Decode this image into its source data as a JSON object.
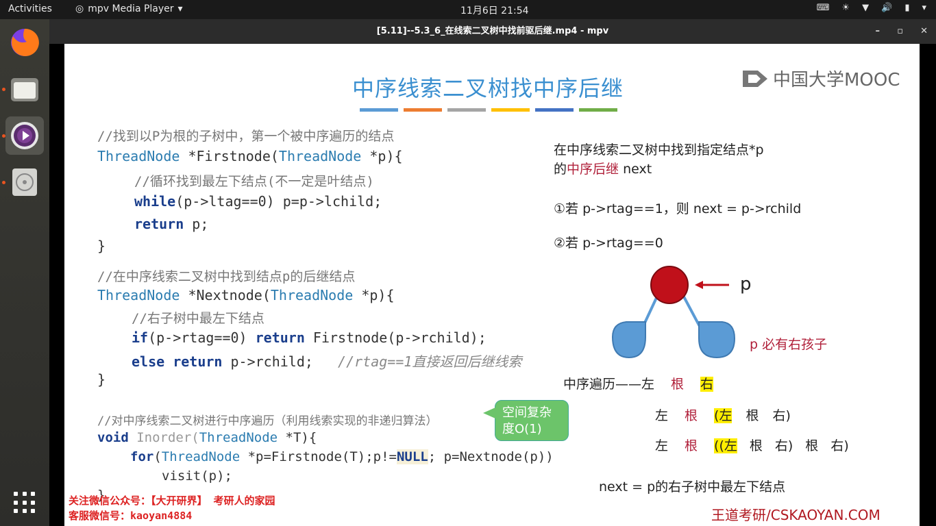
{
  "topbar": {
    "activities": "Activities",
    "app_menu": "mpv Media Player",
    "clock": "11月6日  21:54"
  },
  "window": {
    "title": "[5.11]--5.3_6_在线索二叉树中找前驱后继.mp4 - mpv",
    "minimize": "–",
    "maximize": "▫",
    "close": "✕"
  },
  "slide": {
    "title": "中序线索二叉树找中序后继",
    "logo_text": "中国大学MOOC",
    "bar_colors": [
      "#5b9bd5",
      "#ed7d31",
      "#a5a5a5",
      "#ffc000",
      "#4472c4",
      "#70ad47"
    ],
    "code1": {
      "comment": "//找到以P为根的子树中，第一个被中序遍历的结点",
      "sig_type": "ThreadNode",
      "sig_rest": " *Firstnode(",
      "sig_type2": "ThreadNode",
      "sig_end": " *p){",
      "loop_comment": "//循环找到最左下结点(不一定是叶结点)",
      "while_kw": "while",
      "while_body": "(p->ltag==0) p=p->lchild;",
      "return_kw": "return",
      "return_body": " p;",
      "close": "}"
    },
    "code2": {
      "comment": "//在中序线索二叉树中找到结点p的后继结点",
      "sig_type": "ThreadNode",
      "sig_rest": " *Nextnode(",
      "sig_type2": "ThreadNode",
      "sig_end": " *p){",
      "sub_comment": "//右子树中最左下结点",
      "if_kw": "if",
      "if_body": "(p->rtag==0) ",
      "if_return": "return",
      "if_rest": " Firstnode(p->rchild);",
      "else_kw": "else",
      "else_return": "return",
      "else_rest": " p->rchild;",
      "else_comment": "   //rtag==1直接返回后继线索",
      "close": "}"
    },
    "code3": {
      "comment": "//对中序线索二叉树进行中序遍历（利用线索实现的非递归算法）",
      "void_kw": "void",
      "fn_name": " Inorder(",
      "sig_type": "ThreadNode",
      "sig_end": " *T){",
      "for_kw": "for",
      "for_open": "(",
      "for_type": "ThreadNode",
      "for_mid": " *p=Firstnode(T);p!=",
      "null": "NULL",
      "for_end": "; p=Nextnode(p))",
      "visit": "visit(p);",
      "close": "}"
    },
    "bubble": "空间复杂度O(1)",
    "right": {
      "line1": "在中序线索二叉树中找到指定结点*p",
      "line2_pre": "的",
      "line2_red": "中序后继",
      "line2_post": " next",
      "case1": "①若 p->rtag==1，则 next = p->rchild",
      "case2": "②若 p->rtag==0",
      "p_label": "p",
      "must_right": "p 必有右孩子",
      "inorder_label": "中序遍历——",
      "row1": [
        "左",
        "根",
        "右"
      ],
      "row2": [
        "左",
        "根",
        "(左",
        "根",
        "右)"
      ],
      "row3": [
        "左",
        "根",
        "((左",
        "根",
        "右)",
        "根",
        "右)"
      ],
      "conclusion": "next = p的右子树中最左下结点"
    },
    "watermark1": "关注微信公众号：【大开研界】 考研人的家园",
    "watermark2": "客服微信号：kaoyan4884",
    "site": "王道考研/CSKAOYAN.COM"
  }
}
